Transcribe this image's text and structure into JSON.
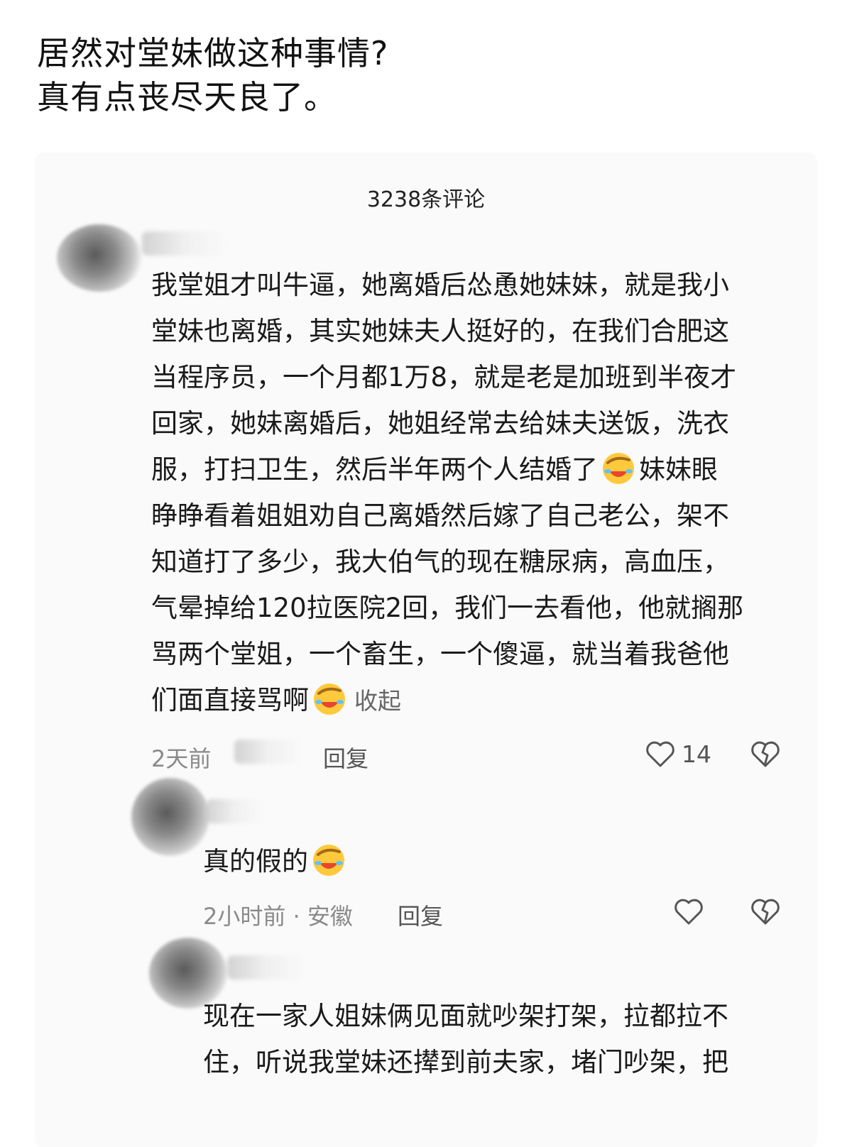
{
  "headline": {
    "line1": "居然对堂妹做这种事情?",
    "line2": "真有点丧尽天良了。"
  },
  "comments_panel": {
    "title": "3238条评论",
    "comments": [
      {
        "lines": [
          "我堂姐才叫牛逼，她离婚后怂恿她妹妹，就是我小",
          "堂妹也离婚，其实她妹夫人挺好的，在我们合肥这",
          "当程序员，一个月都1万8，就是老是加班到半夜才",
          "回家，她妹离婚后，她姐经常去给妹夫送饭，洗衣",
          "服，打扫卫生，然后半年两个人结婚了",
          "妹妹眼",
          "睁睁看着姐姐劝自己离婚然后嫁了自己老公，架不",
          "知道打了多少，我大伯气的现在糖尿病，高血压，",
          "气晕掉给120拉医院2回，我们一去看他，他就搁那",
          "骂两个堂姐，一个畜生，一个傻逼，就当着我爸他",
          "们面直接骂啊"
        ],
        "collapse_label": "收起",
        "time": "2天前",
        "reply_label": "回复",
        "like_count": "14"
      },
      {
        "text": "真的假的",
        "time": "2小时前 · 安徽",
        "reply_label": "回复"
      },
      {
        "lines": [
          "现在一家人姐妹俩见面就吵架打架，拉都拉不",
          "住，听说我堂妹还撵到前夫家，堵门吵架，把"
        ]
      }
    ]
  },
  "icons": {
    "emoji": "facepalm-laugh-emoji",
    "like": "heart-outline-icon",
    "dislike": "broken-heart-icon"
  },
  "colors": {
    "text": "#1a1a1a",
    "meta": "#8a8a8a",
    "card_bg": "#fafafa",
    "emoji_face": "#ffc93c",
    "emoji_mouth": "#e8452c"
  }
}
